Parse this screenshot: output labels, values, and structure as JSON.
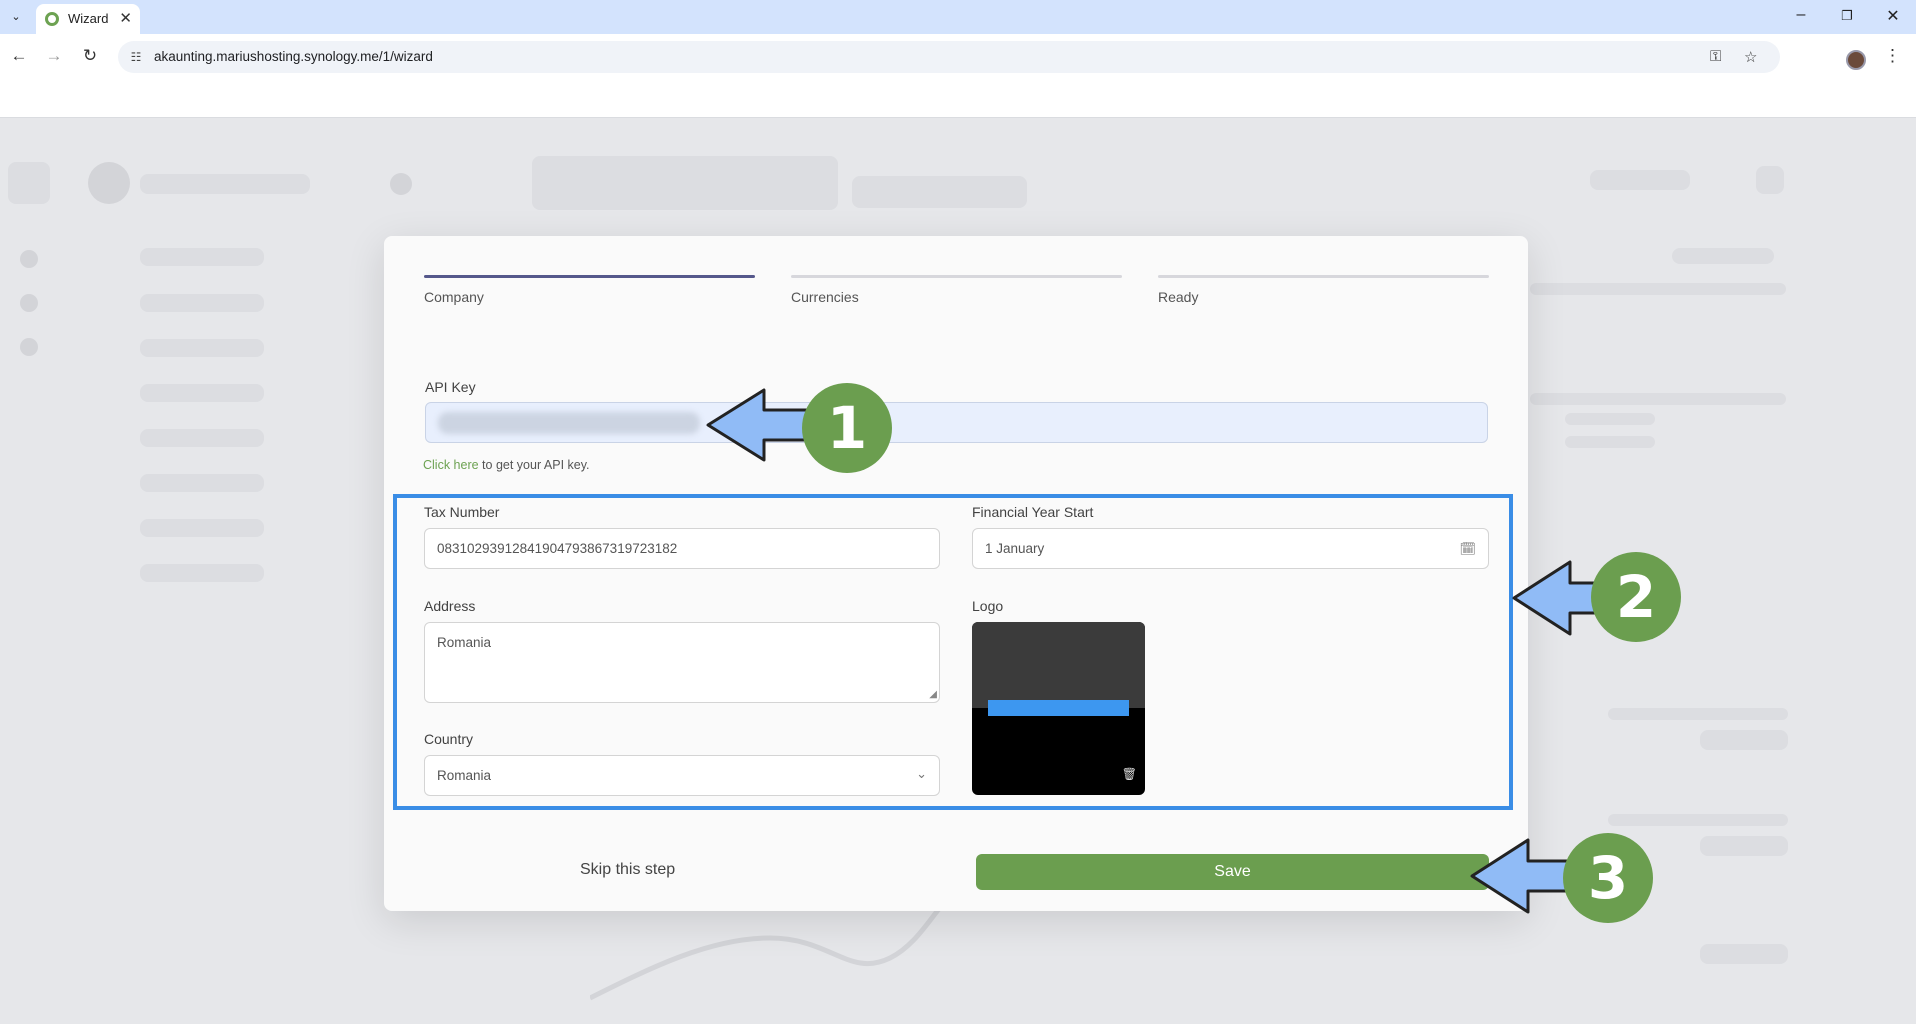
{
  "browser": {
    "tab_title": "Wizard",
    "url": "akaunting.mariushosting.synology.me/1/wizard"
  },
  "wizard": {
    "steps": [
      {
        "label": "Company",
        "active": true
      },
      {
        "label": "Currencies",
        "active": false
      },
      {
        "label": "Ready",
        "active": false
      }
    ],
    "api_key": {
      "label": "API Key",
      "helper_link": "Click here",
      "helper_text": " to get your API key."
    },
    "tax_number": {
      "label": "Tax Number",
      "value": "083102939128419047938673197231​82"
    },
    "financial_year_start": {
      "label": "Financial Year Start",
      "value": "1 January"
    },
    "address": {
      "label": "Address",
      "value": "Romania"
    },
    "logo": {
      "label": "Logo"
    },
    "country": {
      "label": "Country",
      "value": "Romania"
    },
    "skip_label": "Skip this step",
    "save_label": "Save"
  },
  "annotations": {
    "badge_1": "1",
    "badge_2": "2",
    "badge_3": "3"
  },
  "colors": {
    "accent_green": "#6b9e4f",
    "active_step": "#55588b",
    "highlight_blue": "#3a8de6",
    "arrow_fill": "#90bbf6"
  }
}
